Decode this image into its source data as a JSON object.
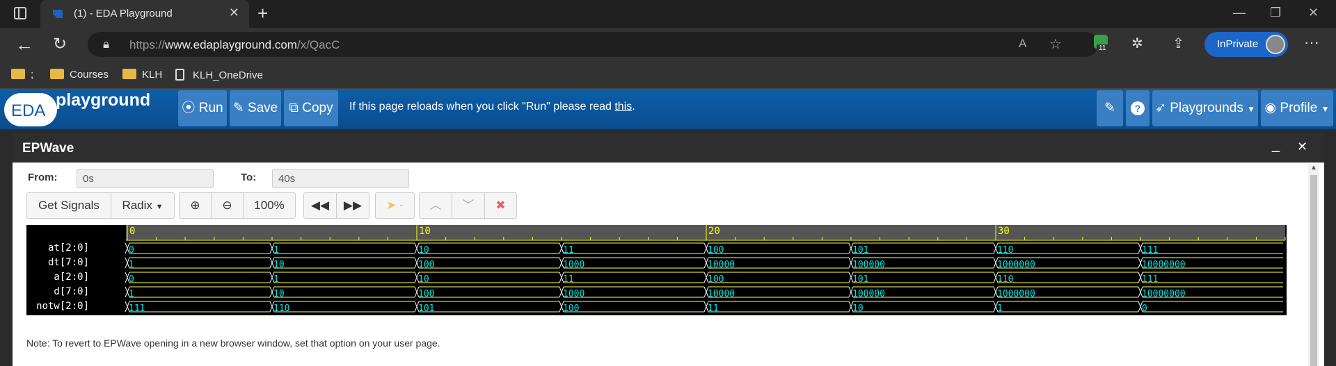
{
  "browser": {
    "tab_title": "(1) - EDA Playground",
    "url_prefix": "https://",
    "url_domain": "www.edaplayground.com",
    "url_path": "/x/QacC",
    "inprivate_label": "InPrivate",
    "badge_count": "11",
    "bookmarks": [
      ";",
      "Courses",
      "KLH",
      "KLH_OneDrive"
    ]
  },
  "eda": {
    "logo_eda": "EDA",
    "logo_playground": "playground",
    "run_label": "Run",
    "save_label": "Save",
    "copy_label": "Copy",
    "notice_text": "If this page reloads when you click \"Run\" please read ",
    "notice_link": "this",
    "notice_end": ".",
    "playgrounds_label": "Playgrounds",
    "profile_label": "Profile"
  },
  "epwave": {
    "title": "EPWave",
    "from_label": "From:",
    "from_value": "0s",
    "to_label": "To:",
    "to_value": "40s",
    "get_signals_label": "Get Signals",
    "radix_label": "Radix",
    "zoom_level": "100%",
    "cursor_label": "-",
    "note": "Note: To revert to EPWave opening in a new browser window, set that option on your user page.",
    "time_axis": {
      "major_ticks": [
        0,
        10,
        20,
        30
      ],
      "labels": [
        "0",
        "10",
        "20",
        "30"
      ],
      "range": [
        0,
        40
      ]
    },
    "signals": [
      {
        "name": "at[2:0]",
        "values": [
          "0",
          "1",
          "10",
          "11",
          "100",
          "101",
          "110",
          "111"
        ]
      },
      {
        "name": "dt[7:0]",
        "values": [
          "1",
          "10",
          "100",
          "1000",
          "10000",
          "100000",
          "1000000",
          "10000000"
        ]
      },
      {
        "name": "a[2:0]",
        "values": [
          "0",
          "1",
          "10",
          "11",
          "100",
          "101",
          "110",
          "111"
        ]
      },
      {
        "name": "d[7:0]",
        "values": [
          "1",
          "10",
          "100",
          "1000",
          "10000",
          "100000",
          "1000000",
          "10000000"
        ]
      },
      {
        "name": "notw[2:0]",
        "values": [
          "111",
          "110",
          "101",
          "100",
          "11",
          "10",
          "1",
          "0"
        ]
      }
    ],
    "change_times": [
      0,
      5,
      10,
      15,
      20,
      25,
      30,
      35
    ],
    "colors": {
      "wave_line": "#ffff66",
      "wave_text": "#00e5e5",
      "axis_bg": "#555555",
      "tick": "#ffff00"
    }
  }
}
